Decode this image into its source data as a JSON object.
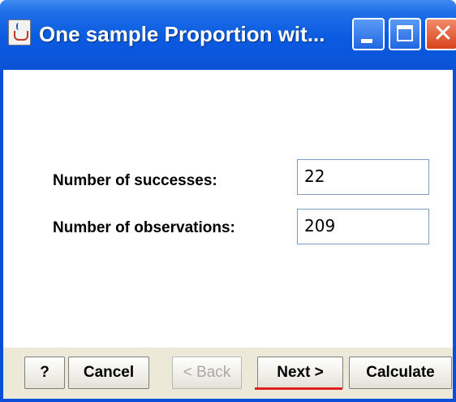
{
  "window": {
    "title": "One sample Proportion wit...",
    "controls": {
      "minimize_icon": "minimize-icon",
      "maximize_icon": "maximize-icon",
      "close_glyph": "✕"
    }
  },
  "form": {
    "successes_label": "Number of successes:",
    "successes_value": "22",
    "observations_label": "Number of observations:",
    "observations_value": "209"
  },
  "buttons": {
    "help": "?",
    "cancel": "Cancel",
    "back": "< Back",
    "next": "Next >",
    "calculate": "Calculate"
  },
  "colors": {
    "titlebar": "#0a5ae0",
    "close_button": "#d8431c",
    "annotation_underline": "#e02020"
  }
}
